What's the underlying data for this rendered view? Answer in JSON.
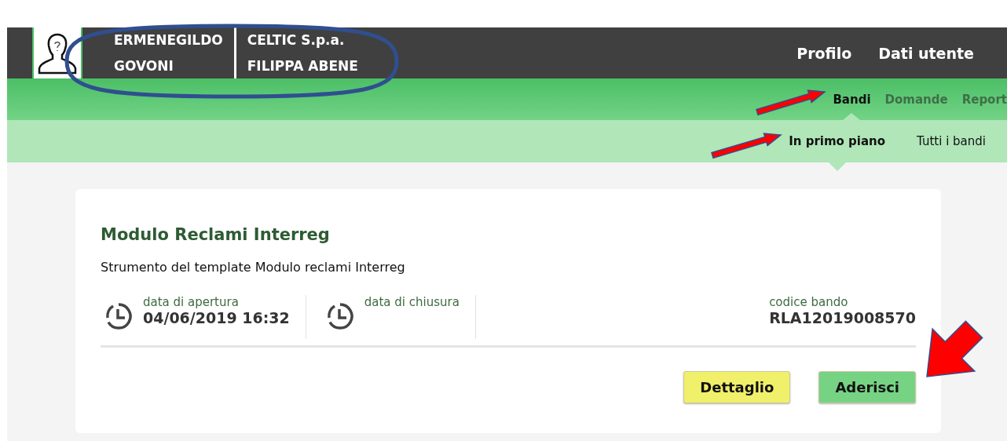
{
  "header": {
    "user": [
      "ERMENEGILDO",
      "GOVONI"
    ],
    "company": [
      "CELTIC S.p.a.",
      "FILIPPA ABENE"
    ],
    "links": [
      "Profilo",
      "Dati utente"
    ]
  },
  "main_nav": [
    {
      "label": "Bandi",
      "selected": true
    },
    {
      "label": "Domande",
      "selected": false
    },
    {
      "label": "Report",
      "selected": false
    }
  ],
  "sub_nav": [
    {
      "label": "In primo piano",
      "selected": true
    },
    {
      "label": "Tutti i bandi",
      "selected": false
    }
  ],
  "card": {
    "title": "Modulo Reclami Interreg",
    "description": "Strumento del template Modulo reclami Interreg",
    "info": [
      {
        "kind": "date",
        "label": "data di apertura",
        "value": "04/06/2019 16:32"
      },
      {
        "kind": "date",
        "label": "data di chiusura"
      },
      {
        "kind": "code",
        "label": "codice bando",
        "value": "RLA12019008570"
      }
    ],
    "buttons": [
      {
        "kind": "detail",
        "label": "Dettaglio"
      },
      {
        "kind": "join",
        "label": "Aderisci"
      }
    ]
  }
}
